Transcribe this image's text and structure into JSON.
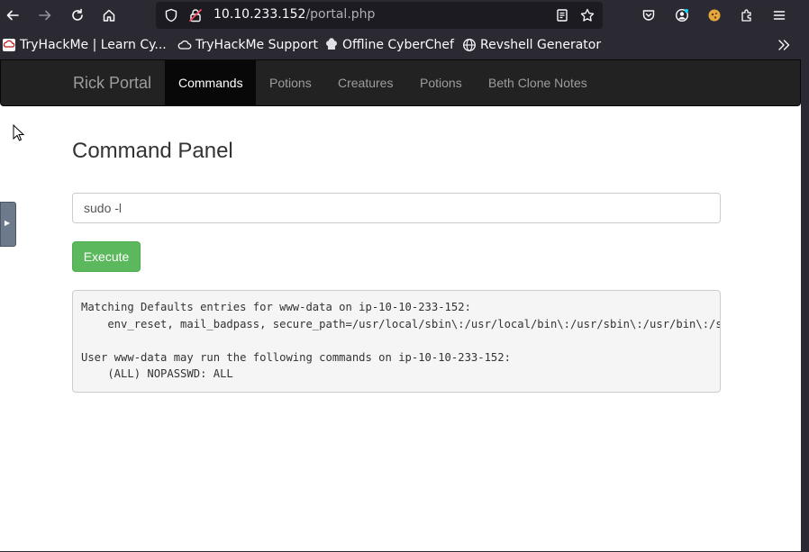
{
  "browser": {
    "url_host": "10.10.233.152",
    "url_path": "/portal.php",
    "icons": [
      "back-arrow-icon",
      "forward-arrow-icon",
      "reload-icon",
      "home-icon",
      "shield-icon",
      "insecure-lock-icon",
      "reader-view-icon",
      "bookmark-star-icon",
      "pocket-icon",
      "account-icon",
      "extension-icon",
      "extensions-puzzle-icon",
      "menu-icon"
    ]
  },
  "bookmarks": [
    {
      "label": "TryHackMe | Learn Cy...",
      "icon": "tryhackme-icon"
    },
    {
      "label": "TryHackMe Support",
      "icon": "cloud-icon"
    },
    {
      "label": "Offline CyberChef",
      "icon": "chef-icon"
    },
    {
      "label": "Revshell Generator",
      "icon": "globe-icon"
    }
  ],
  "navbar": {
    "brand": "Rick Portal",
    "items": [
      {
        "label": "Commands",
        "active": true
      },
      {
        "label": "Potions",
        "active": false
      },
      {
        "label": "Creatures",
        "active": false
      },
      {
        "label": "Potions",
        "active": false
      },
      {
        "label": "Beth Clone Notes",
        "active": false
      }
    ]
  },
  "panel": {
    "title": "Command Panel",
    "command_value": "sudo -l",
    "execute_label": "Execute",
    "output": "Matching Defaults entries for www-data on ip-10-10-233-152:\n    env_reset, mail_badpass, secure_path=/usr/local/sbin\\:/usr/local/bin\\:/usr/sbin\\:/usr/bin\\:/sbin\\:/bin\\:/snap/bin\n\nUser www-data may run the following commands on ip-10-10-233-152:\n    (ALL) NOPASSWD: ALL"
  },
  "colors": {
    "browser_chrome": "#2b2a33",
    "urlbar": "#1c1b22",
    "navbar": "#222222",
    "nav_active": "#080808",
    "execute_button": "#5cb85c",
    "output_bg": "#f5f5f5"
  }
}
